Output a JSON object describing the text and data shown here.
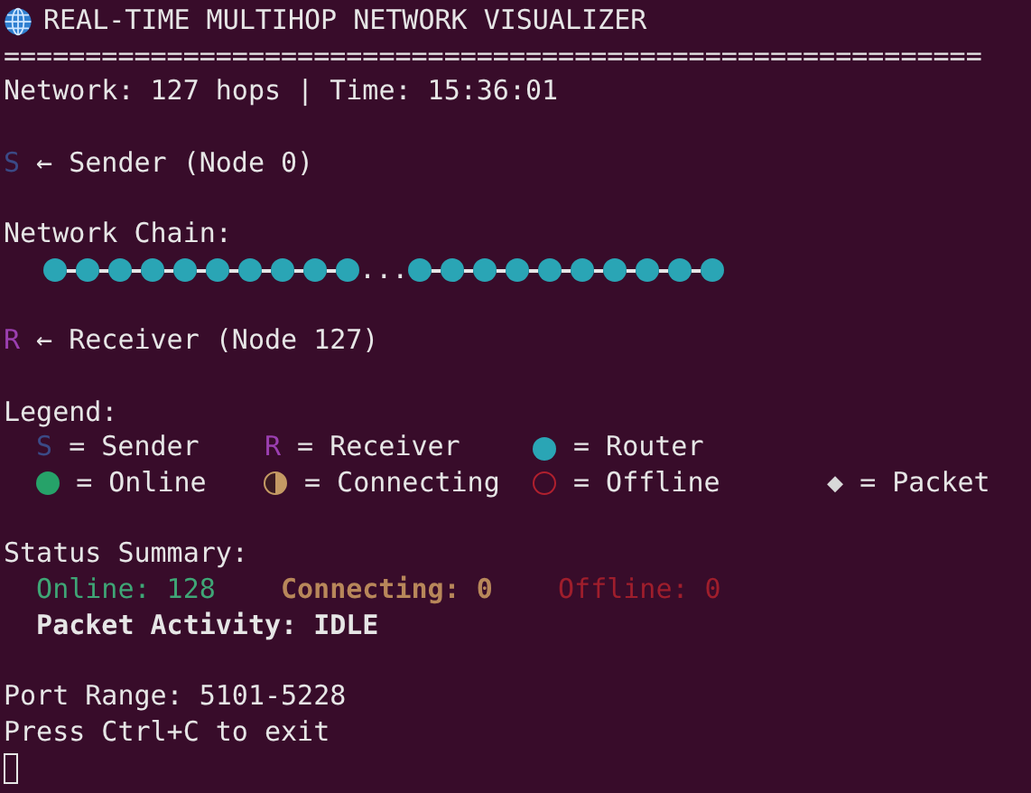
{
  "title": "REAL-TIME MULTIHOP NETWORK VISUALIZER",
  "rule": "============================================================",
  "network_line": "Network: 127 hops | Time: 15:36:01",
  "sender": {
    "symbol": "S",
    "label": "← Sender (Node 0)"
  },
  "chain": {
    "heading": "Network Chain:",
    "nodes": [
      {
        "kind": "router"
      },
      {
        "kind": "router"
      },
      {
        "kind": "router"
      },
      {
        "kind": "router"
      },
      {
        "kind": "router"
      },
      {
        "kind": "router"
      },
      {
        "kind": "router"
      },
      {
        "kind": "router"
      },
      {
        "kind": "router"
      },
      {
        "kind": "router"
      },
      {
        "kind": "gap",
        "text": "..."
      },
      {
        "kind": "router"
      },
      {
        "kind": "router"
      },
      {
        "kind": "router"
      },
      {
        "kind": "router"
      },
      {
        "kind": "router"
      },
      {
        "kind": "router"
      },
      {
        "kind": "router"
      },
      {
        "kind": "router"
      },
      {
        "kind": "router"
      },
      {
        "kind": "router"
      }
    ]
  },
  "receiver": {
    "symbol": "R",
    "label": "← Receiver (Node 127)"
  },
  "legend": {
    "heading": "Legend:",
    "items": [
      {
        "kind": "sender",
        "symbol": "S",
        "label": "= Sender"
      },
      {
        "kind": "receiver",
        "symbol": "R",
        "label": "= Receiver"
      },
      {
        "kind": "router",
        "label": "= Router"
      },
      {
        "kind": "online",
        "label": "= Online"
      },
      {
        "kind": "connecting",
        "label": "= Connecting"
      },
      {
        "kind": "offline",
        "label": "= Offline"
      },
      {
        "kind": "packet",
        "symbol": "◆",
        "label": "= Packet"
      }
    ]
  },
  "status": {
    "heading": "Status Summary:",
    "counts": [
      {
        "kind": "online",
        "text": "Online: 128"
      },
      {
        "kind": "connecting",
        "text": "Connecting: 0"
      },
      {
        "kind": "offline",
        "text": "Offline: 0"
      }
    ],
    "packet_activity": "Packet Activity: IDLE"
  },
  "port_range": "Port Range: 5101-5228",
  "exit_hint": "Press Ctrl+C to exit"
}
